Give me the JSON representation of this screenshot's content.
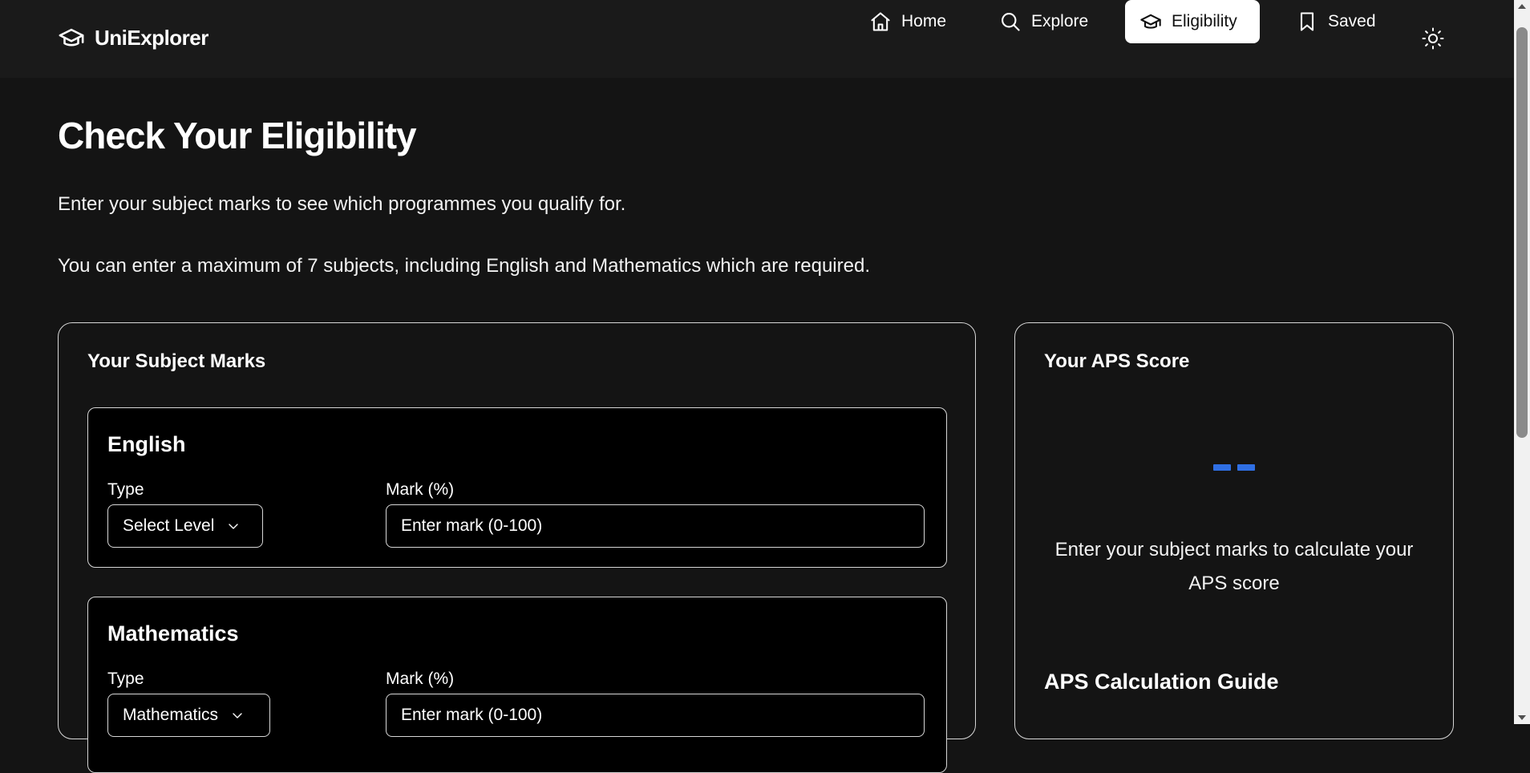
{
  "header": {
    "brand": "UniExplorer",
    "nav": [
      {
        "label": "Home",
        "icon": "home-icon"
      },
      {
        "label": "Explore",
        "icon": "search-icon"
      },
      {
        "label": "Eligibility",
        "icon": "graduation-cap-icon",
        "active": true
      },
      {
        "label": "Saved",
        "icon": "bookmark-icon"
      }
    ],
    "theme_icon": "sun-icon"
  },
  "main": {
    "title": "Check Your Eligibility",
    "intro_1": "Enter your subject marks to see which programmes you qualify for.",
    "intro_2": "You can enter a maximum of 7 subjects, including English and Mathematics which are required."
  },
  "marks_card": {
    "title": "Your Subject Marks",
    "subjects": [
      {
        "name": "English",
        "type_label": "Type",
        "type_value": "Select Level",
        "mark_label": "Mark (%)",
        "mark_placeholder": "Enter mark (0-100)"
      },
      {
        "name": "Mathematics",
        "type_label": "Type",
        "type_value": "Mathematics",
        "mark_label": "Mark (%)",
        "mark_placeholder": "Enter mark (0-100)"
      }
    ]
  },
  "aps_card": {
    "title": "Your APS Score",
    "hint": "Enter your subject marks to calculate your APS score",
    "guide_title": "APS Calculation Guide"
  },
  "colors": {
    "background": "#141414",
    "header": "#1a1a1a",
    "accent": "#2f6fe4"
  }
}
